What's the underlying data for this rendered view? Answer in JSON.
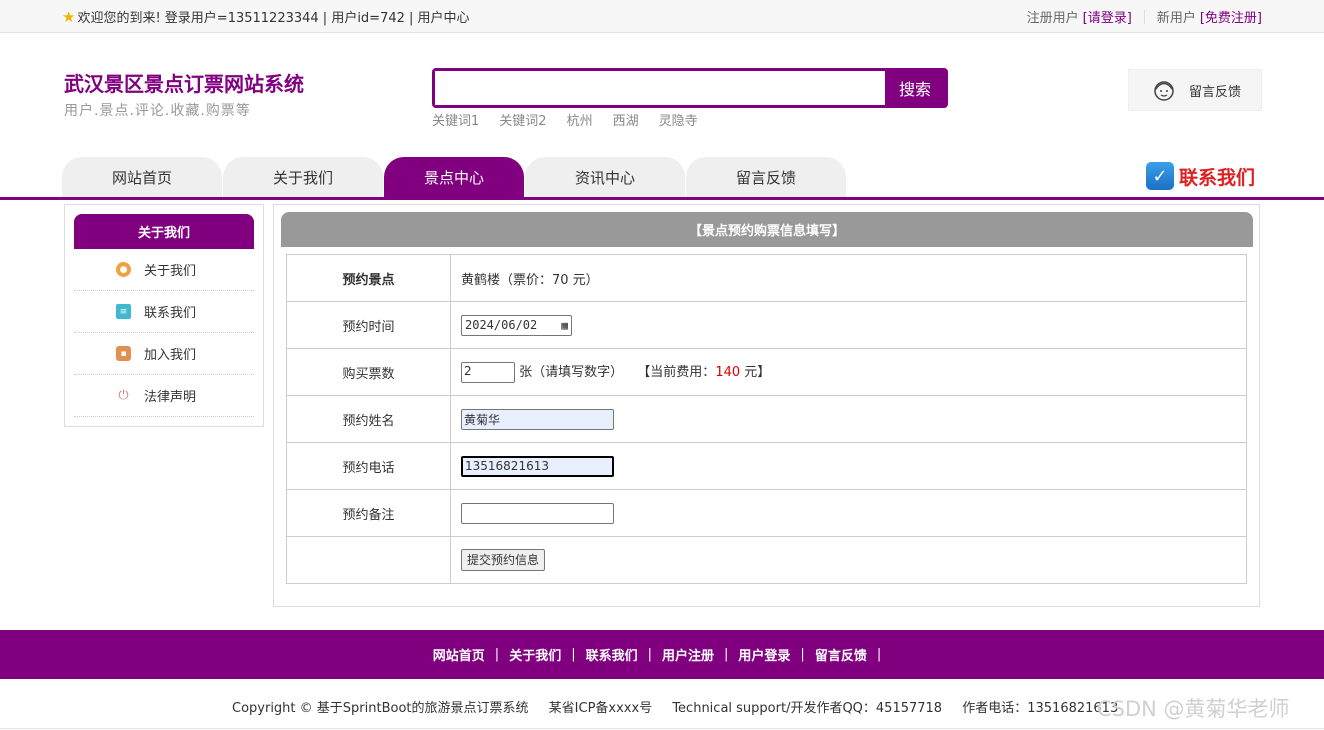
{
  "topbar": {
    "welcome": "欢迎您的到来!  登录用户=13511223344 | 用户id=742 | 用户中心",
    "registered_user": "注册用户",
    "login_link": "[请登录]",
    "new_user": "新用户",
    "register_link": "[免费注册]"
  },
  "header": {
    "site_title": "武汉景区景点订票网站系统",
    "site_subtitle": "用户.景点.评论.收藏.购票等",
    "search_button": "搜索",
    "keywords": [
      "关键词1",
      "关键词2",
      "杭州",
      "西湖",
      "灵隐寺"
    ],
    "feedback_label": "留言反馈"
  },
  "nav": {
    "tabs": [
      {
        "label": "网站首页",
        "active": false
      },
      {
        "label": "关于我们",
        "active": false
      },
      {
        "label": "景点中心",
        "active": true
      },
      {
        "label": "资讯中心",
        "active": false
      },
      {
        "label": "留言反馈",
        "active": false
      }
    ],
    "contact_label": "联系我们"
  },
  "sidebar": {
    "title": "关于我们",
    "items": [
      {
        "label": "关于我们",
        "icon": "orange-circle-icon",
        "color": "#f0a040"
      },
      {
        "label": "联系我们",
        "icon": "clipboard-icon",
        "color": "#40b8d0"
      },
      {
        "label": "加入我们",
        "icon": "lock-icon",
        "color": "#e09050"
      },
      {
        "label": "法律声明",
        "icon": "power-icon",
        "color": "#d08080"
      }
    ]
  },
  "form": {
    "title": "【景点预约购票信息填写】",
    "spot_label": "预约景点",
    "spot_value": "黄鹤楼（票价：70 元）",
    "date_label": "预约时间",
    "date_value": "2024/06/02",
    "qty_label": "购买票数",
    "qty_value": "2",
    "qty_hint": "张（请填写数字）",
    "fee_prefix": "【当前费用：",
    "fee_value": "140",
    "fee_suffix": " 元】",
    "name_label": "预约姓名",
    "name_value": "黄菊华",
    "phone_label": "预约电话",
    "phone_value": "13516821613",
    "note_label": "预约备注",
    "note_value": "",
    "submit_label": "提交预约信息"
  },
  "footer": {
    "links": [
      "网站首页",
      "关于我们",
      "联系我们",
      "用户注册",
      "用户登录",
      "留言反馈"
    ],
    "copyright": "Copyright © 基于SprintBoot的旅游景点订票系统",
    "icp": "某省ICP备xxxx号",
    "support": "Technical support/开发作者QQ：45157718",
    "phone": "作者电话：13516821613",
    "watermark": "CSDN @黄菊华老师"
  },
  "colors": {
    "brand": "#800080",
    "fee": "#dd0000",
    "contact": "#e02020"
  }
}
